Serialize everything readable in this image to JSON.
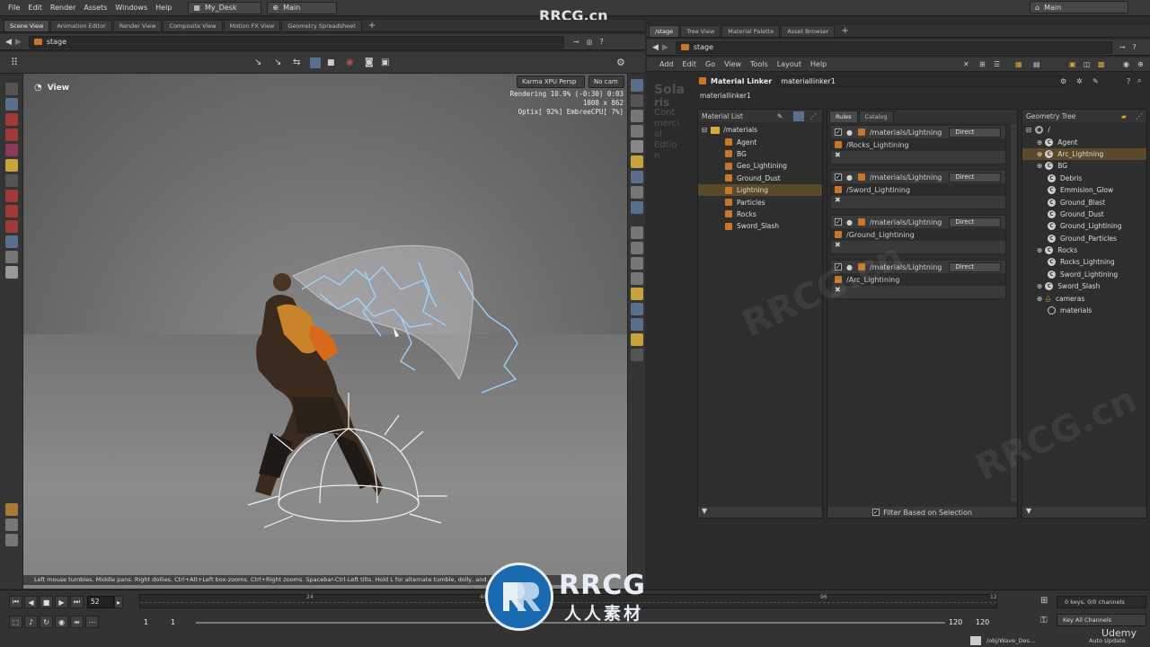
{
  "menubar": {
    "items": [
      "File",
      "Edit",
      "Render",
      "Assets",
      "Windows",
      "Help"
    ],
    "desktop": "My_Desk",
    "context": "Main",
    "right_context": "Main"
  },
  "watermark_top": "RRCG.cn",
  "left_tabs": [
    "Scene View",
    "Animation Editor",
    "Render View",
    "Composite View",
    "Motion FX View",
    "Geometry Spreadsheet"
  ],
  "left_path": "stage",
  "viewport": {
    "label": "View",
    "renderer": "Karma XPU Persp",
    "camera": "No cam",
    "stats": [
      "Rendering  10.9% (-0:30)  0:03",
      "1008 x 862",
      "Optix[ 92%] EmbreeCPU[  7%]"
    ],
    "status_hint": "Left mouse tumbles. Middle pans. Right dollies. Ctrl+Alt+Left box-zooms. Ctrl+Right zooms. Spacebar-Ctrl-Left tilts. Hold L for alternate tumble, dolly, and"
  },
  "right_tabs": [
    "/stage",
    "Tree View",
    "Material Palette",
    "Asset Browser"
  ],
  "right_path": "stage",
  "right_menu": [
    "Add",
    "Edit",
    "Go",
    "View",
    "Tools",
    "Layout",
    "Help"
  ],
  "node": {
    "type_label": "Material Linker",
    "name": "materiallinker1",
    "name_line": "materiallinker1"
  },
  "material_list": {
    "title": "Material List",
    "root": "/materials",
    "items": [
      "Agent",
      "BG",
      "Geo_Lightining",
      "Ground_Dust",
      "Lightning",
      "Particles",
      "Rocks",
      "Sword_Slash"
    ],
    "selected": "Lightning"
  },
  "rules_tabs": [
    "Rules",
    "Catalog"
  ],
  "rules": [
    {
      "material": "/materials/Lightning",
      "mode": "Direct",
      "target": "/Rocks_Lightining"
    },
    {
      "material": "/materials/Lightning",
      "mode": "Direct",
      "target": "/Sword_Lightining"
    },
    {
      "material": "/materials/Lightning",
      "mode": "Direct",
      "target": "/Ground_Lightining"
    },
    {
      "material": "/materials/Lightning",
      "mode": "Direct",
      "target": "/Arc_Lightining"
    }
  ],
  "filter_label": "Filter Based on Selection",
  "geometry_tree": {
    "title": "Geometry Tree",
    "root": "/",
    "items": [
      "Agent",
      "Arc_Lightning",
      "BG",
      "Debris",
      "Emmision_Glow",
      "Ground_Blast",
      "Ground_Dust",
      "Ground_Lightining",
      "Ground_Particles",
      "Rocks",
      "Rocks_Lightning",
      "Sword_Lightining",
      "Sword_Slash",
      "cameras",
      "materials"
    ],
    "selected": "Arc_Lightning"
  },
  "ghost_text": [
    "Sola",
    "ris",
    "Cont",
    "merci",
    "al",
    "Edtio",
    "n"
  ],
  "timeline": {
    "frame": "52",
    "ticks": [
      "24",
      "48",
      "96",
      "12"
    ],
    "start": "1",
    "start2": "1",
    "end": "120",
    "end2": "120",
    "keys": "0 keys, 0/0 channels",
    "key_mode": "Key All Channels",
    "path": "/obj/Wave_Des...",
    "update": "Auto Update"
  },
  "brand": {
    "logo_main": "RRCG",
    "logo_sub": "人人素材",
    "udemy": "Udemy"
  },
  "colors": {
    "accent": "#c8762a",
    "selected_row": "#5b4a2a",
    "lightning": "#9fd8ff"
  }
}
